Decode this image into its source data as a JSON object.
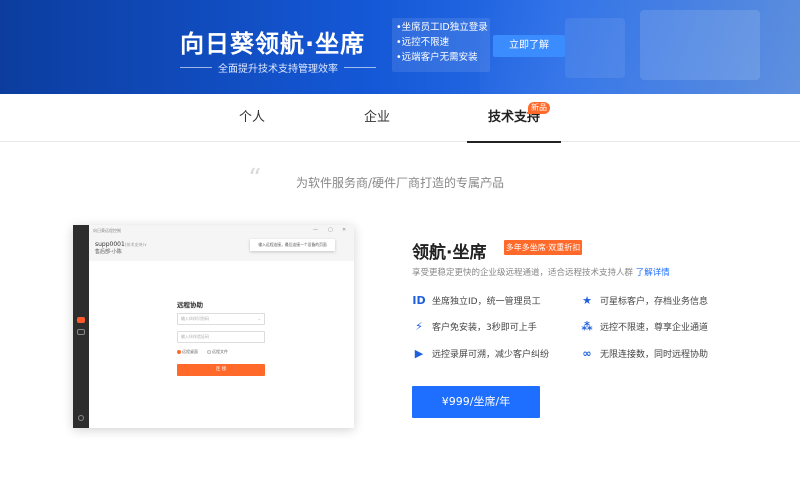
{
  "banner": {
    "title": "向日葵领航·坐席",
    "subtitle": "全面提升技术支持管理效率",
    "points": [
      "•坐席员工ID独立登录",
      "•远控不限速",
      "•远端客户无需安装"
    ],
    "cta_label": "立即了解"
  },
  "tabs": [
    {
      "label": "个人",
      "active": false
    },
    {
      "label": "企业",
      "active": false
    },
    {
      "label": "技术支持",
      "active": true,
      "badge": "新品"
    }
  ],
  "slogan": "为软件服务商/硬件厂商打造的专属产品",
  "mock_window": {
    "title": "向日葵远程控制",
    "controls": [
      "—",
      "▢",
      "✕"
    ],
    "user_name": "supp0001",
    "user_tag": "(技术支持)∨",
    "user_group": "售后部-小陈",
    "tip": "输入远程连接，最后连接一个设备的页面",
    "form_title": "远程协助",
    "input1_placeholder": "输入伙伴识别码",
    "input2_placeholder": "输入伙伴验证码",
    "option1": "远程桌面",
    "option2": "远程文件",
    "connect_label": "连 接"
  },
  "product": {
    "title": "领航·坐席",
    "badge": "多年多坐席·双重折扣",
    "desc": "享受更稳定更快的企业级远程通道，适合远程技术支持人群",
    "more_link": "了解详情",
    "features": [
      {
        "icon": "id-icon",
        "glyph": "ID",
        "text": "坐席独立ID，统一管理员工"
      },
      {
        "icon": "star-icon",
        "glyph": "★",
        "text": "可星标客户，存档业务信息"
      },
      {
        "icon": "lightning-icon",
        "glyph": "⚡",
        "text": "客户免安装，3秒即可上手"
      },
      {
        "icon": "network-icon",
        "glyph": "⁂",
        "text": "远控不限速，尊享企业通道"
      },
      {
        "icon": "video-icon",
        "glyph": "▶",
        "text": "远控录屏可溯，减少客户纠纷"
      },
      {
        "icon": "infinity-icon",
        "glyph": "∞",
        "text": "无限连接数，同时远程协助"
      }
    ],
    "price_label": "¥999/坐席/年"
  },
  "colors": {
    "accent": "#1e6fff",
    "orange": "#ff6a2b",
    "banner": "#1457d6"
  }
}
